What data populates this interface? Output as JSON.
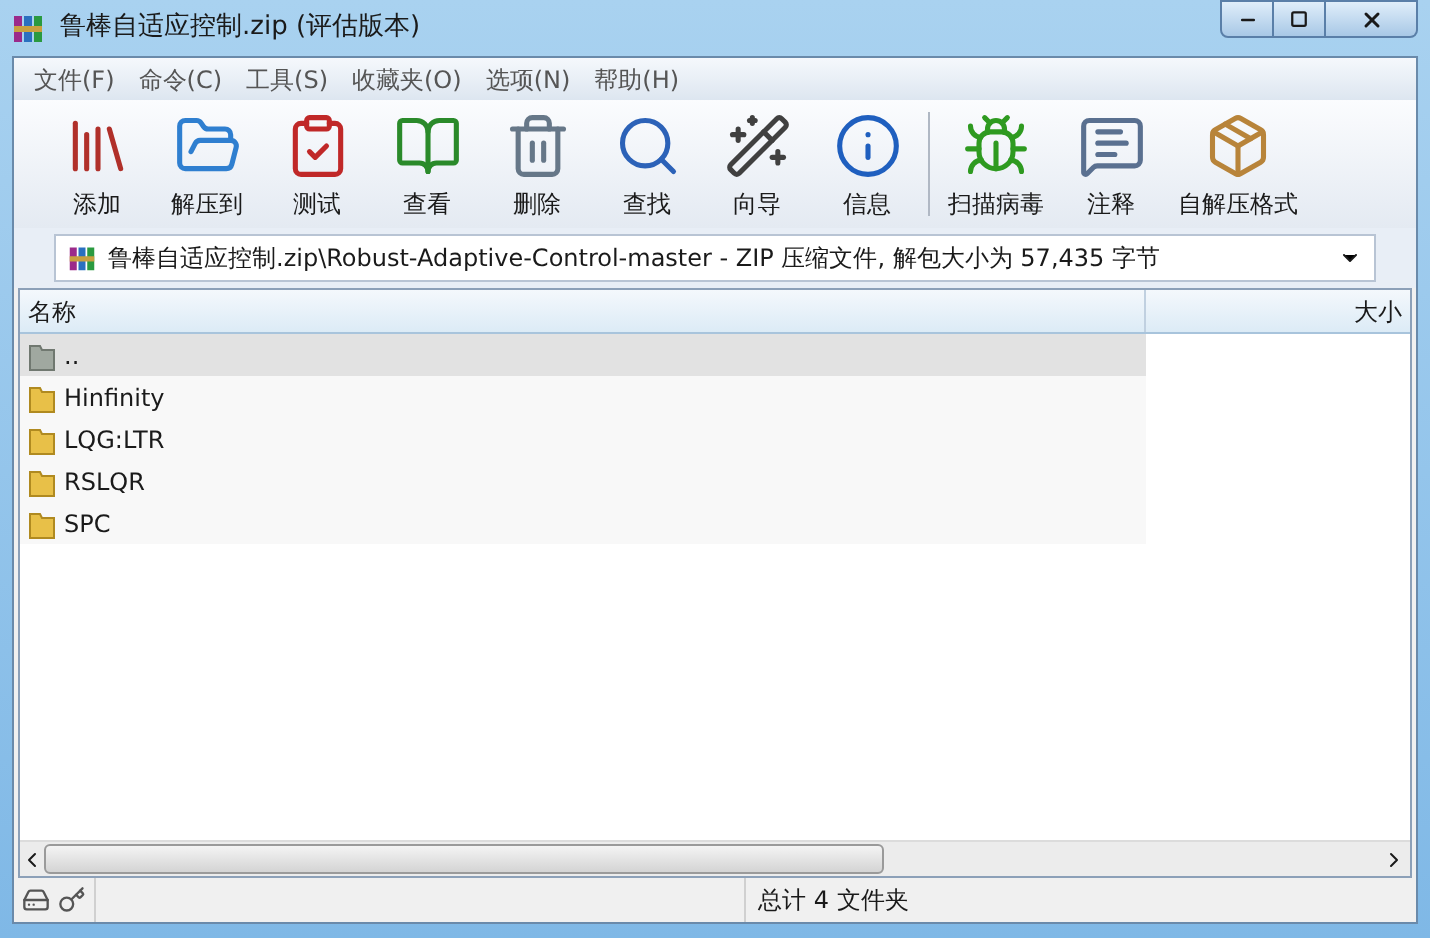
{
  "window": {
    "title": "鲁棒自适应控制.zip (评估版本)"
  },
  "menu": [
    "文件(F)",
    "命令(C)",
    "工具(S)",
    "收藏夹(O)",
    "选项(N)",
    "帮助(H)"
  ],
  "toolbar": [
    {
      "label": "添加",
      "kind": "add"
    },
    {
      "label": "解压到",
      "kind": "extract"
    },
    {
      "label": "测试",
      "kind": "test"
    },
    {
      "label": "查看",
      "kind": "view"
    },
    {
      "label": "删除",
      "kind": "delete"
    },
    {
      "label": "查找",
      "kind": "find"
    },
    {
      "label": "向导",
      "kind": "wizard"
    },
    {
      "label": "信息",
      "kind": "info"
    },
    {
      "label": "扫描病毒",
      "kind": "scan"
    },
    {
      "label": "注释",
      "kind": "comment"
    },
    {
      "label": "自解压格式",
      "kind": "sfx"
    }
  ],
  "address": {
    "path": "鲁棒自适应控制.zip\\Robust-Adaptive-Control-master - ZIP 压缩文件, 解包大小为 57,435 字节"
  },
  "table": {
    "columns": [
      "名称",
      "大小"
    ],
    "rows": [
      {
        "name": "..",
        "kind": "up",
        "selected": true
      },
      {
        "name": "Hinfinity",
        "kind": "folder",
        "selected": false
      },
      {
        "name": "LQG:LTR",
        "kind": "folder",
        "selected": false
      },
      {
        "name": "RSLQR",
        "kind": "folder",
        "selected": false
      },
      {
        "name": "SPC",
        "kind": "folder",
        "selected": false
      }
    ]
  },
  "status_bar": {
    "text": "总计 4 文件夹"
  }
}
